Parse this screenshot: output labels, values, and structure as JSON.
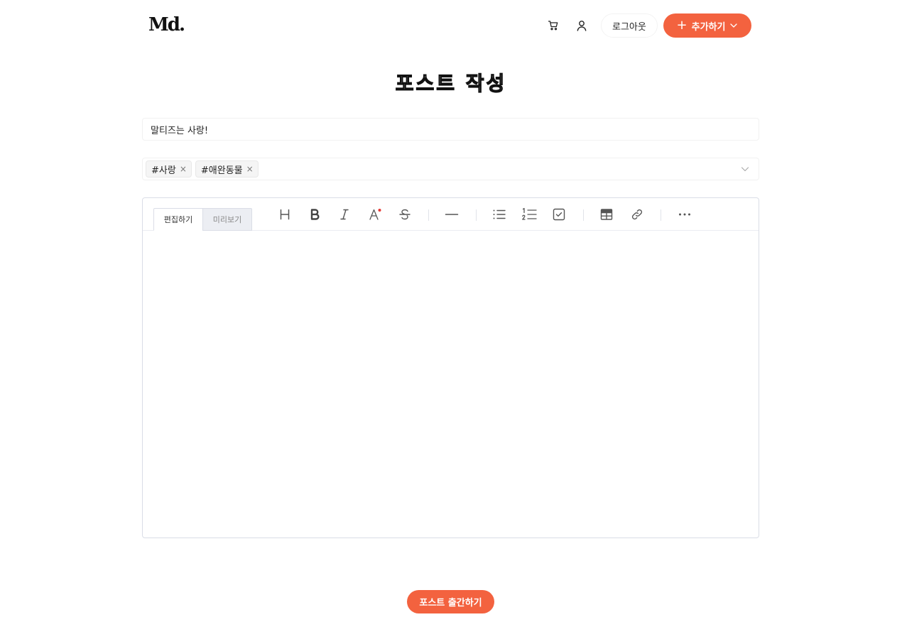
{
  "header": {
    "logo": "Md.",
    "cart_icon": "shopping-cart-icon",
    "user_icon": "user-icon",
    "logout_label": "로그아웃",
    "add_label": "추가하기",
    "accent_color": "#f3623f"
  },
  "page": {
    "title": "포스트 작성"
  },
  "form": {
    "title_value": "말티즈는 사랑!",
    "tags": [
      {
        "label": "#사랑"
      },
      {
        "label": "#애완동물"
      }
    ]
  },
  "editor": {
    "tabs": [
      {
        "label": "편집하기",
        "active": true
      },
      {
        "label": "미리보기",
        "active": false
      }
    ],
    "toolbar_icons": [
      "heading-icon",
      "bold-icon",
      "italic-icon",
      "text-color-icon",
      "strikethrough-icon",
      "horizontal-line-icon",
      "bullet-list-icon",
      "ordered-list-icon",
      "task-list-icon",
      "table-icon",
      "link-icon",
      "more-icon"
    ],
    "content": ""
  },
  "footer": {
    "publish_label": "포스트 출간하기"
  }
}
